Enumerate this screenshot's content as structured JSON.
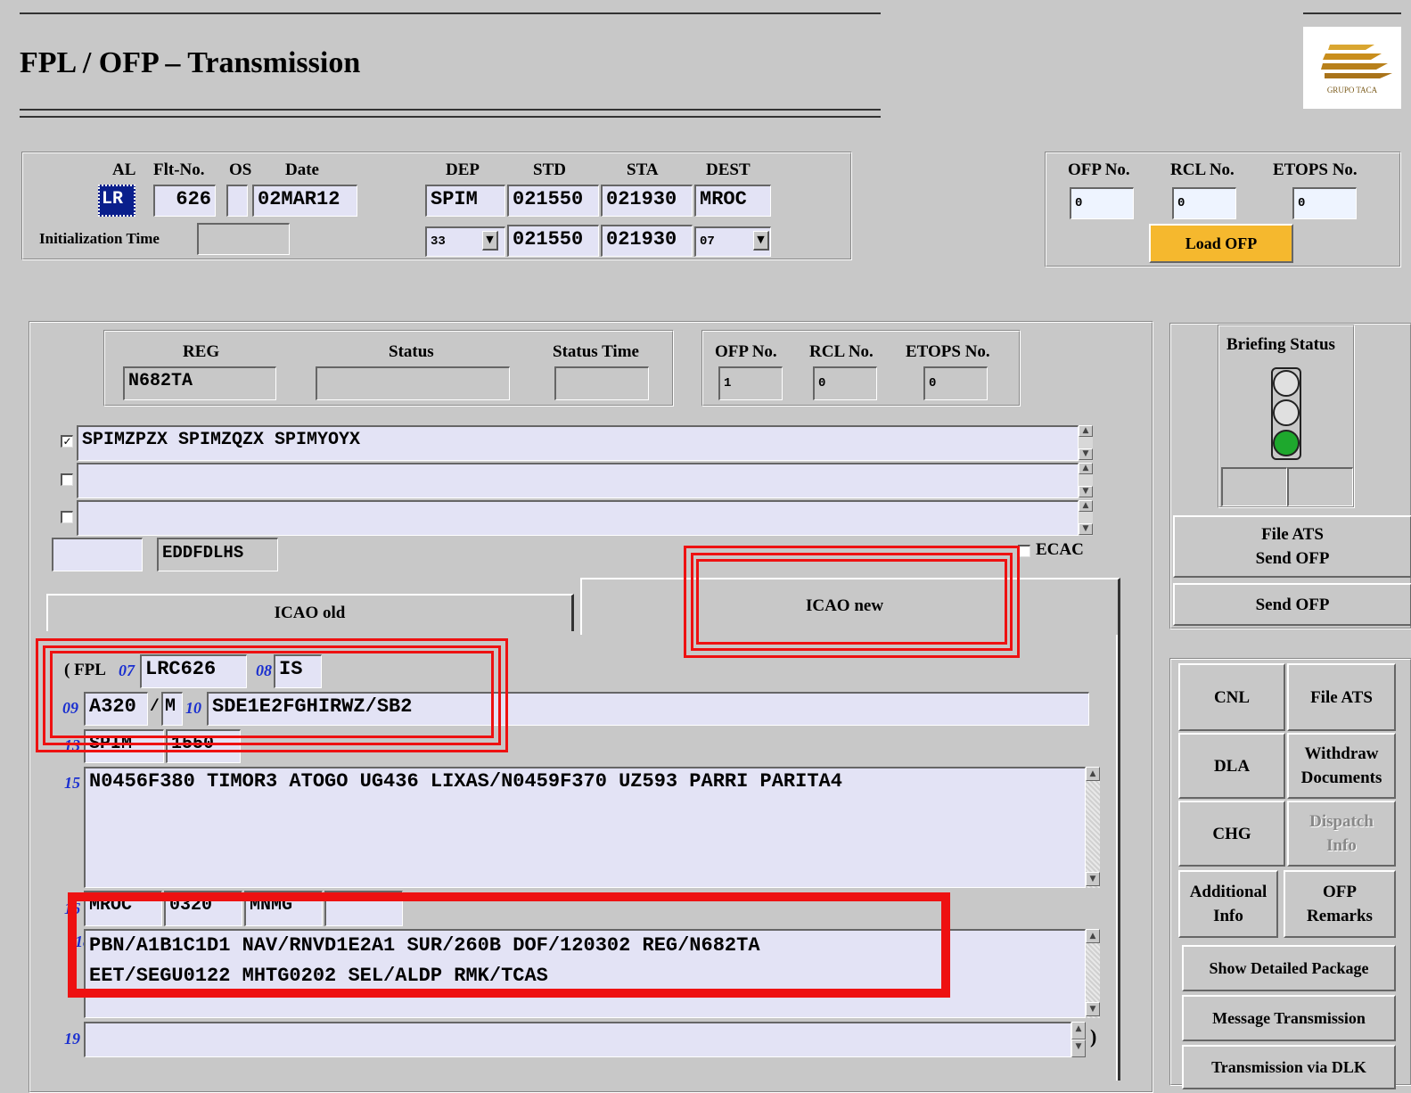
{
  "window": {
    "title": "FPL / OFP – Transmission",
    "logo_text": "GRUPO TACA"
  },
  "flight": {
    "labels": {
      "al": "AL",
      "flt_no": "Flt-No.",
      "os": "OS",
      "date": "Date",
      "dep": "DEP",
      "std": "STD",
      "sta": "STA",
      "dest": "DEST",
      "init_time": "Initialization Time"
    },
    "al": "LR",
    "flt_no": "626",
    "os": "",
    "date": "02MAR12",
    "dep": "SPIM",
    "std": "021550",
    "sta": "021930",
    "dest": "MROC",
    "dep_rwy": "33",
    "std2": "021550",
    "sta2": "021930",
    "dest_rwy": "07",
    "init_time": ""
  },
  "ofp_top": {
    "labels": {
      "ofp_no": "OFP No.",
      "rcl_no": "RCL No.",
      "etops_no": "ETOPS No."
    },
    "ofp_no": "0",
    "rcl_no": "0",
    "etops_no": "0",
    "load_button": "Load OFP"
  },
  "reg_panel": {
    "labels": {
      "reg": "REG",
      "status": "Status",
      "status_time": "Status Time",
      "ofp_no": "OFP No.",
      "rcl_no": "RCL No.",
      "etops_no": "ETOPS No."
    },
    "reg": "N682TA",
    "status": "",
    "status_time": "",
    "ofp_no": "1",
    "rcl_no": "0",
    "etops_no": "0"
  },
  "addresses": [
    {
      "checked": true,
      "value": "SPIMZPZX SPIMZQZX SPIMYOYX"
    },
    {
      "checked": false,
      "value": ""
    },
    {
      "checked": false,
      "value": ""
    }
  ],
  "originator": {
    "prefix": "",
    "value": "EDDFDLHS",
    "ecac_label": "ECAC",
    "ecac_checked": false
  },
  "tabs": {
    "old": "ICAO old",
    "new": "ICAO new"
  },
  "fpl": {
    "open": "( FPL",
    "n07": "07",
    "callsign": "LRC626",
    "n08": "08",
    "rules": "IS",
    "n09": "09",
    "actype": "A320",
    "slash": "/",
    "wake": "M",
    "n10": "10",
    "equipment": "SDE1E2FGHIRWZ/SB2",
    "n13": "13",
    "dep_ad": "SPIM",
    "dep_time": "1550",
    "n15": "15",
    "route": "N0456F380 TIMOR3 ATOGO UG436 LIXAS/N0459F370 UZ593 PARRI PARITA4",
    "n16": "16",
    "dest_ad": "MROC",
    "eet": "0320",
    "altn1": "MNMG",
    "altn2": "",
    "n18": "18",
    "other_line1": "PBN/A1B1C1D1 NAV/RNVD1E2A1 SUR/260B DOF/120302 REG/N682TA",
    "other_line2": "EET/SEGU0122 MHTG0202 SEL/ALDP RMK/TCAS",
    "n19": "19",
    "field19": "",
    "close": ")"
  },
  "briefing": {
    "title": "Briefing Status",
    "light": "green"
  },
  "side_buttons": {
    "file_ats_send_ofp": [
      "File ATS",
      "Send OFP"
    ],
    "send_ofp": "Send OFP",
    "cnl": "CNL",
    "file_ats": "File ATS",
    "dla": "DLA",
    "withdraw": [
      "Withdraw",
      "Documents"
    ],
    "chg": "CHG",
    "dispatch": [
      "Dispatch",
      "Info"
    ],
    "additional": [
      "Additional",
      "Info"
    ],
    "ofp_remarks": [
      "OFP",
      "Remarks"
    ],
    "show_detailed": "Show Detailed Package",
    "message_transmission": "Message Transmission",
    "transmission_dlk": "Transmission via DLK"
  },
  "colors": {
    "background": "#c8c8c8",
    "field": "#e3e3f5",
    "accent_button": "#f5b82e",
    "highlight": "#ee1111",
    "field_number": "#1a2fd0"
  }
}
